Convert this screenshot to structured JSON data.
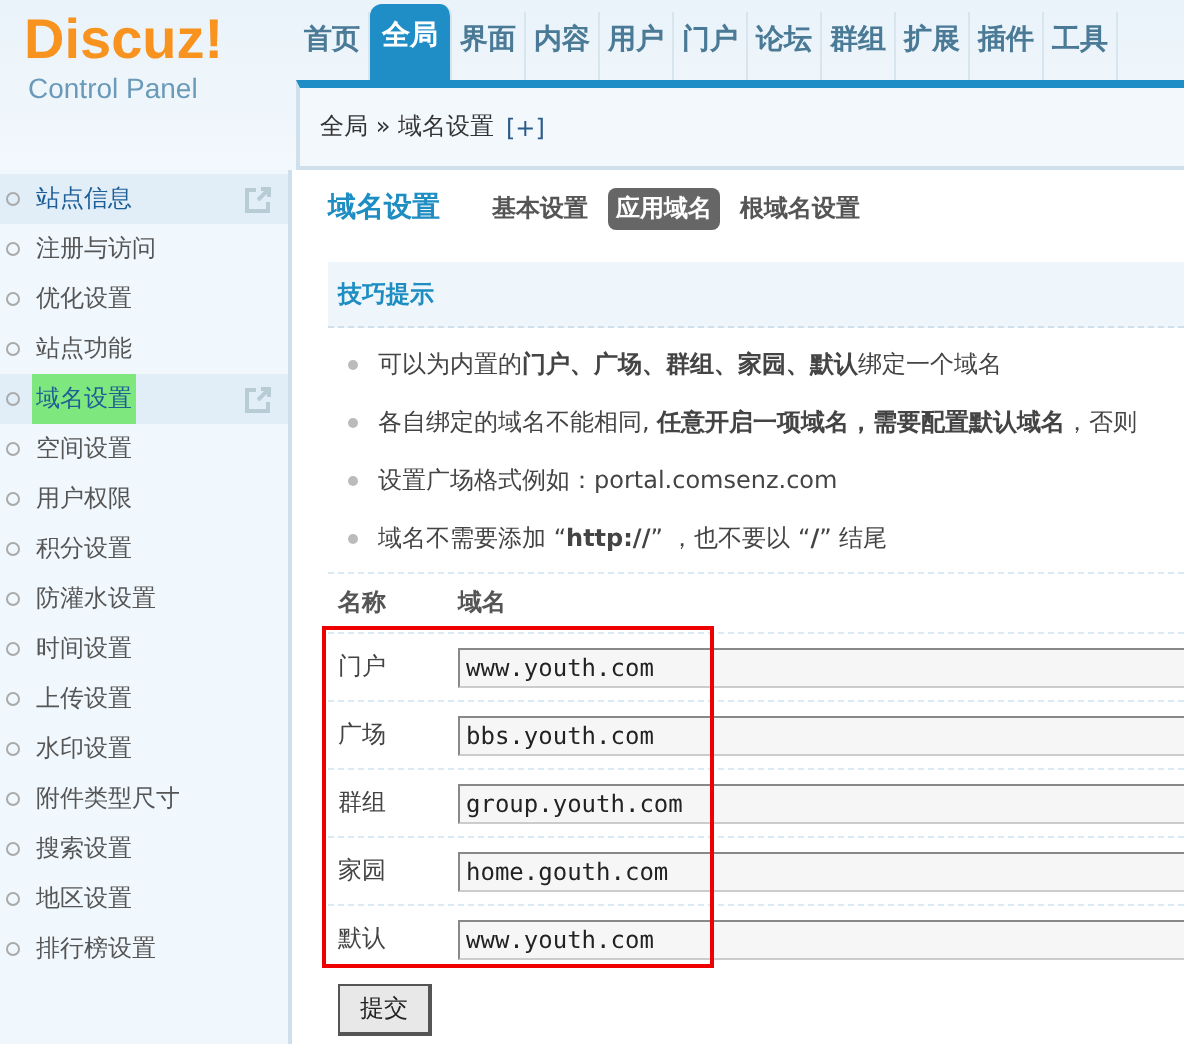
{
  "logo": {
    "name": "Discuz!",
    "subtitle": "Control Panel"
  },
  "nav": [
    {
      "label": "首页",
      "selected": false
    },
    {
      "label": "全局",
      "selected": true
    },
    {
      "label": "界面",
      "selected": false
    },
    {
      "label": "内容",
      "selected": false
    },
    {
      "label": "用户",
      "selected": false
    },
    {
      "label": "门户",
      "selected": false
    },
    {
      "label": "论坛",
      "selected": false
    },
    {
      "label": "群组",
      "selected": false
    },
    {
      "label": "扩展",
      "selected": false
    },
    {
      "label": "插件",
      "selected": false
    },
    {
      "label": "工具",
      "selected": false
    }
  ],
  "breadcrumb": {
    "path": "全局 » 域名设置",
    "add": "[+]"
  },
  "sidebar": {
    "items": [
      {
        "label": "站点信息",
        "pinned": true,
        "selected": false
      },
      {
        "label": "注册与访问",
        "pinned": false,
        "selected": false
      },
      {
        "label": "优化设置",
        "pinned": false,
        "selected": false
      },
      {
        "label": "站点功能",
        "pinned": false,
        "selected": false
      },
      {
        "label": "域名设置",
        "pinned": true,
        "selected": true
      },
      {
        "label": "空间设置",
        "pinned": false,
        "selected": false
      },
      {
        "label": "用户权限",
        "pinned": false,
        "selected": false
      },
      {
        "label": "积分设置",
        "pinned": false,
        "selected": false
      },
      {
        "label": "防灌水设置",
        "pinned": false,
        "selected": false
      },
      {
        "label": "时间设置",
        "pinned": false,
        "selected": false
      },
      {
        "label": "上传设置",
        "pinned": false,
        "selected": false
      },
      {
        "label": "水印设置",
        "pinned": false,
        "selected": false
      },
      {
        "label": "附件类型尺寸",
        "pinned": false,
        "selected": false
      },
      {
        "label": "搜索设置",
        "pinned": false,
        "selected": false
      },
      {
        "label": "地区设置",
        "pinned": false,
        "selected": false
      },
      {
        "label": "排行榜设置",
        "pinned": false,
        "selected": false
      }
    ]
  },
  "page": {
    "title": "域名设置",
    "tabs": [
      {
        "label": "基本设置",
        "selected": false
      },
      {
        "label": "应用域名",
        "selected": true
      },
      {
        "label": "根域名设置",
        "selected": false
      }
    ]
  },
  "tips": {
    "title": "技巧提示",
    "items": [
      "可以为内置的**门户、广场、群组、家园、默认**绑定一个域名",
      "各自绑定的域名不能相同, **任意开启一项域名，需要配置默认域名**，否则",
      "设置广场格式例如：portal.comsenz.com",
      "域名不需要添加 “**http://**” ，也不要以 “**/**” 结尾"
    ]
  },
  "table": {
    "columns": [
      "名称",
      "域名"
    ],
    "rows": [
      {
        "name": "门户",
        "value": "www.youth.com"
      },
      {
        "name": "广场",
        "value": "bbs.youth.com"
      },
      {
        "name": "群组",
        "value": "group.youth.com"
      },
      {
        "name": "家园",
        "value": "home.gouth.com"
      },
      {
        "name": "默认",
        "value": "www.youth.com"
      }
    ]
  },
  "submit": "提交"
}
